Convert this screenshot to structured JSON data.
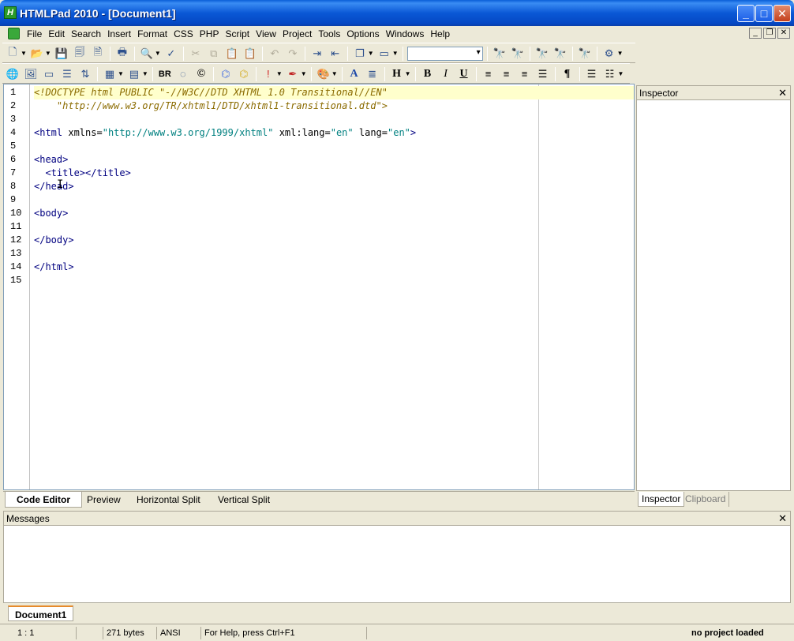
{
  "window": {
    "title": "HTMLPad 2010 - [Document1]",
    "app_icon_letter": "H"
  },
  "menu": [
    "File",
    "Edit",
    "Search",
    "Insert",
    "Format",
    "CSS",
    "PHP",
    "Script",
    "View",
    "Project",
    "Tools",
    "Options",
    "Windows",
    "Help"
  ],
  "toolbar1": {
    "font_combo_value": ""
  },
  "toolbar2": {
    "br_label": "BR",
    "copyright_symbol": "©",
    "font_a_label": "A",
    "heading_label": "H",
    "bold_label": "B",
    "italic_label": "I",
    "underline_label": "U",
    "pilcrow_label": "¶"
  },
  "editor": {
    "line_numbers": [
      "1",
      "2",
      "3",
      "4",
      "5",
      "6",
      "7",
      "8",
      "9",
      "10",
      "11",
      "12",
      "13",
      "14",
      "15"
    ],
    "current_line": 1
  },
  "editor_tabs": [
    "Code Editor",
    "Preview",
    "Horizontal Split",
    "Vertical Split"
  ],
  "inspector": {
    "title": "Inspector",
    "tabs": [
      "Inspector",
      "Clipboard"
    ]
  },
  "messages": {
    "title": "Messages"
  },
  "document_tabs": [
    "Document1"
  ],
  "status": {
    "position": "1 : 1",
    "size": "271 bytes",
    "encoding": "ANSI",
    "help": "For Help, press Ctrl+F1",
    "project": "no project loaded"
  }
}
